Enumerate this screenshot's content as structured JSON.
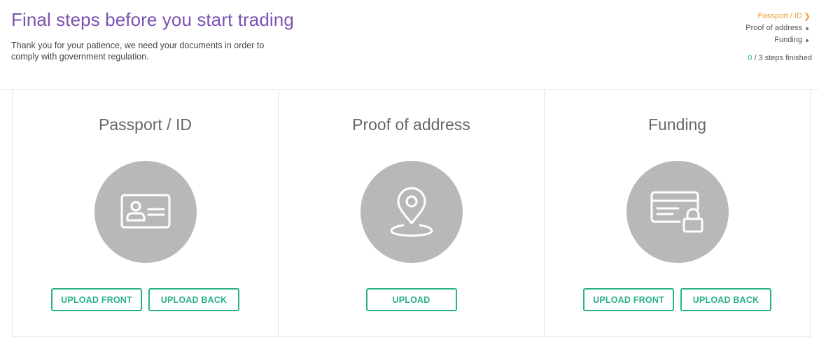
{
  "header": {
    "title": "Final steps before you start trading",
    "subtitle": "Thank you for your patience, we need your documents in order to comply with government regulation."
  },
  "steps": {
    "items": [
      {
        "label": "Passport / ID",
        "state": "active"
      },
      {
        "label": "Proof of address",
        "state": "pending"
      },
      {
        "label": "Funding",
        "state": "pending"
      }
    ],
    "progress_done": "0",
    "progress_rest": " / 3 steps finished"
  },
  "cards": [
    {
      "title": "Passport / ID",
      "icon": "id-card-icon",
      "buttons": [
        "UPLOAD FRONT",
        "UPLOAD BACK"
      ]
    },
    {
      "title": "Proof of address",
      "icon": "location-pin-icon",
      "buttons": [
        "UPLOAD"
      ]
    },
    {
      "title": "Funding",
      "icon": "locked-card-icon",
      "buttons": [
        "UPLOAD FRONT",
        "UPLOAD BACK"
      ]
    }
  ],
  "colors": {
    "title": "#7b52b0",
    "accent": "#2ab08a",
    "active_step": "#f0a030",
    "icon_circle": "#b8b8b8"
  }
}
